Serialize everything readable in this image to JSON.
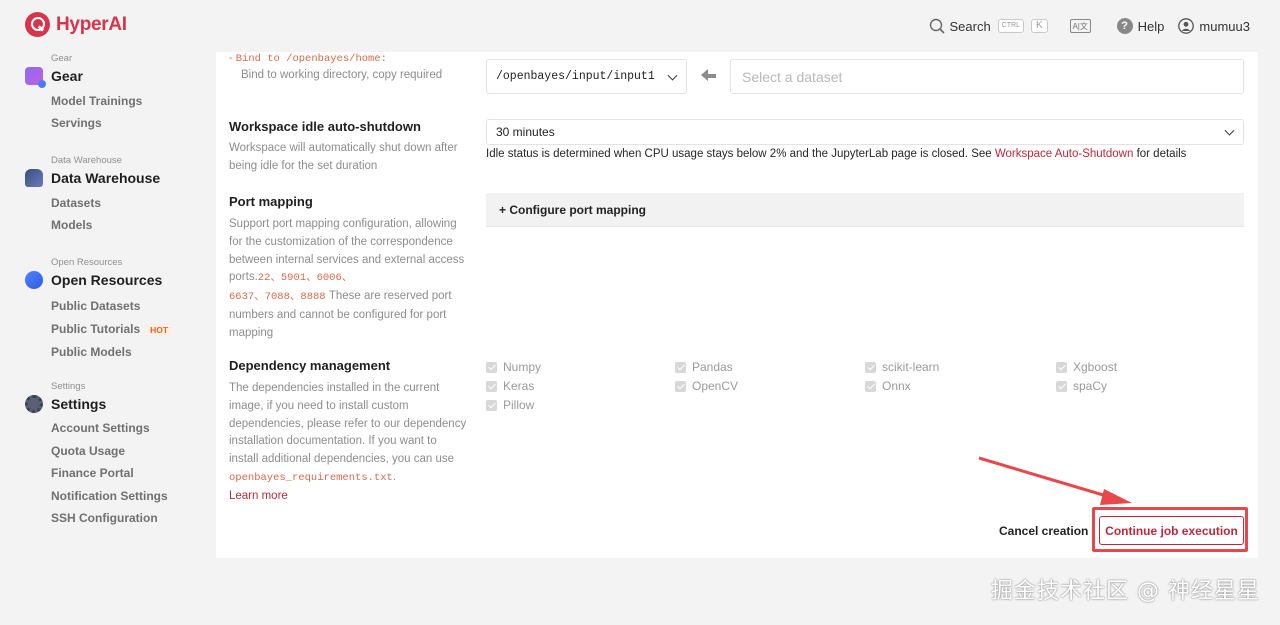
{
  "brand": {
    "name": "HyperAI",
    "color": "#d6344a"
  },
  "topnav": {
    "search_label": "Search",
    "search_key_1": "CTRL",
    "search_key_2": "K",
    "lang_icon": "translate-icon",
    "lang_text": "A|文",
    "help_label": "Help",
    "username": "mumuu3"
  },
  "sidebar": {
    "sections": [
      {
        "sub": "Gear",
        "title": "Gear",
        "icon": "gear-cube-icon",
        "items": [
          "Model Trainings",
          "Servings"
        ]
      },
      {
        "sub": "Data Warehouse",
        "title": "Data Warehouse",
        "icon": "database-icon",
        "items": [
          "Datasets",
          "Models"
        ]
      },
      {
        "sub": "Open Resources",
        "title": "Open Resources",
        "icon": "open-resources-icon",
        "items": [
          "Public Datasets",
          "Public Tutorials",
          "Public Models"
        ]
      },
      {
        "sub": "Settings",
        "title": "Settings",
        "icon": "settings-icon",
        "items": [
          "Account Settings",
          "Quota Usage",
          "Finance Portal",
          "Notification Settings",
          "SSH Configuration"
        ]
      }
    ],
    "hot_badge": "HOT"
  },
  "form": {
    "bind": {
      "label_dash": "- ",
      "label_code": "Bind to /openbayes/home:",
      "desc": "Bind to working directory, copy required",
      "path_value": "/openbayes/input/input1",
      "dataset_placeholder": "Select a dataset"
    },
    "idle": {
      "label": "Workspace idle auto-shutdown",
      "desc": "Workspace will automatically shut down after being idle for the set duration",
      "value": "30 minutes",
      "note_prefix": "Idle status is determined when CPU usage stays below 2% and the JupyterLab page is closed. See ",
      "note_link": "Workspace Auto-Shutdown",
      "note_suffix": " for details"
    },
    "port": {
      "label": "Port mapping",
      "desc_1": "Support port mapping configuration, allowing for the customization of the correspondence between internal services and external access ports.",
      "ports_line1": "22、5901、6006、",
      "ports_line2": "6637、7088、8888",
      "desc_2": " These are reserved port numbers and cannot be configured for port mapping",
      "button": "+ Configure port mapping"
    },
    "deps": {
      "label": "Dependency management",
      "desc_1": "The dependencies installed in the current image, if you need to install custom dependencies, please refer to our dependency installation documentation. If you want to install additional dependencies, you can use ",
      "req_file": "openbayes_requirements.txt",
      "desc_2": ".",
      "learn_more": "Learn more",
      "items": [
        "Numpy",
        "Pandas",
        "scikit-learn",
        "Xgboost",
        "Keras",
        "OpenCV",
        "Onnx",
        "spaCy",
        "Pillow"
      ]
    }
  },
  "actions": {
    "cancel": "Cancel creation",
    "continue": "Continue job execution"
  },
  "watermark": "掘金技术社区 @ 神经星星",
  "colors": {
    "accent": "#c0283b",
    "annotation": "#e8474c"
  }
}
